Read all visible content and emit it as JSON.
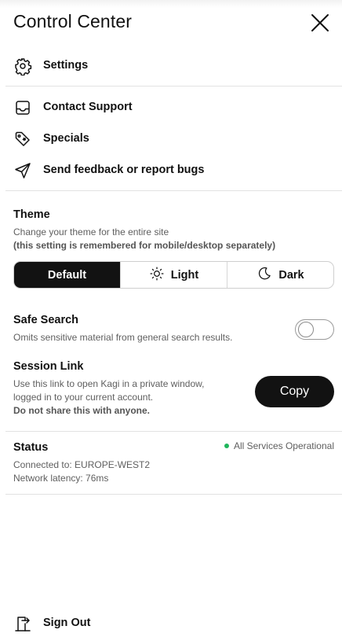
{
  "header": {
    "title": "Control Center",
    "close_icon": "close-icon"
  },
  "menu": {
    "settings": {
      "label": "Settings",
      "icon": "gear-icon"
    },
    "contact_support": {
      "label": "Contact Support",
      "icon": "inbox-icon"
    },
    "specials": {
      "label": "Specials",
      "icon": "tag-icon"
    },
    "feedback": {
      "label": "Send feedback or report bugs",
      "icon": "send-icon"
    }
  },
  "theme": {
    "title": "Theme",
    "desc": "Change your theme for the entire site",
    "note": "(this setting is remembered for mobile/desktop separately)",
    "options": [
      {
        "label": "Default",
        "selected": true
      },
      {
        "label": "Light",
        "icon": "sun-icon"
      },
      {
        "label": "Dark",
        "icon": "moon-icon"
      }
    ]
  },
  "safe_search": {
    "title": "Safe Search",
    "desc": "Omits sensitive material from general search results.",
    "enabled": false
  },
  "session_link": {
    "title": "Session Link",
    "desc_line1": "Use this link to open Kagi in a private window,",
    "desc_line2": "logged in to your current account.",
    "warning": "Do not share this with anyone.",
    "copy_label": "Copy"
  },
  "status": {
    "title": "Status",
    "indicator": "All Services Operational",
    "indicator_color": "#1fb65c",
    "connected": "Connected to: EUROPE-WEST2",
    "latency": "Network latency: 76ms"
  },
  "footer": {
    "sign_out_label": "Sign Out",
    "icon": "sign-out-icon"
  },
  "colors": {
    "accent": "#121212",
    "divider": "#e2e2e2",
    "muted_text": "#5f5f5f"
  }
}
